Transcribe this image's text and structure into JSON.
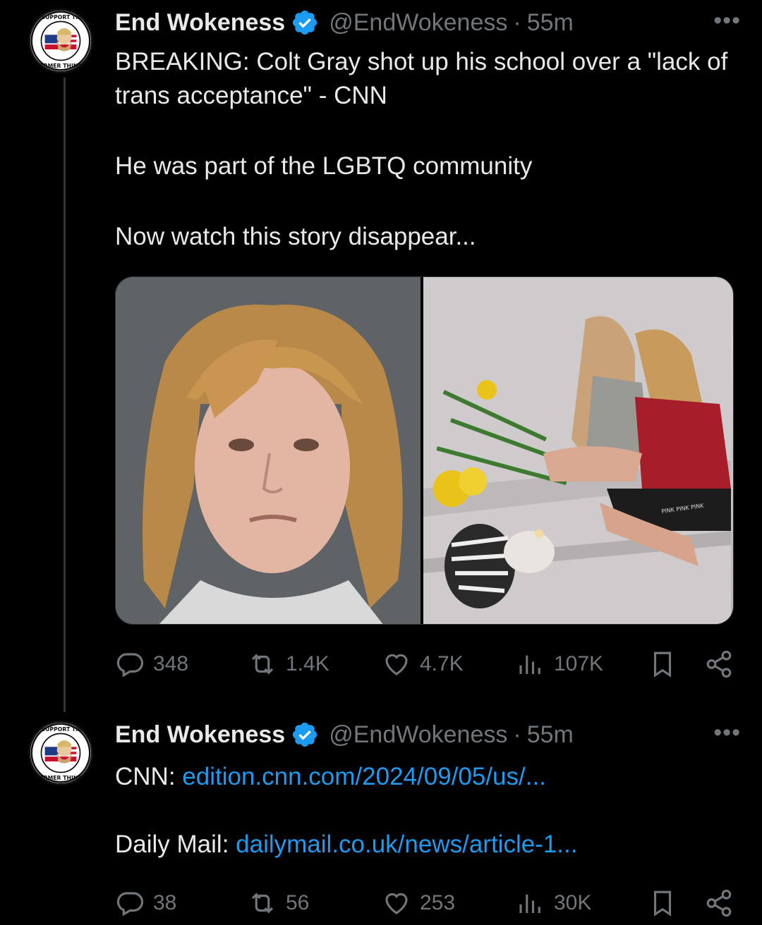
{
  "tweets": [
    {
      "author_name": "End Wokeness",
      "handle": "@EndWokeness",
      "separator": "·",
      "time": "55m",
      "more": "•••",
      "avatar_text_top": "I SUPPORT THE",
      "avatar_text_bottom": "FORMER THINGS",
      "lines": [
        "BREAKING: Colt Gray shot up his school over a \"lack of trans acceptance\" - CNN",
        "He was part of the LGBTQ community",
        "Now watch this story disappear..."
      ],
      "photo_right_texts": [
        "PINK PINK PINK"
      ],
      "stats": {
        "replies": "348",
        "reposts": "1.4K",
        "likes": "4.7K",
        "views": "107K"
      }
    },
    {
      "author_name": "End Wokeness",
      "handle": "@EndWokeness",
      "separator": "·",
      "time": "55m",
      "more": "•••",
      "avatar_text_top": "I SUPPORT THE",
      "avatar_text_bottom": "FORMER THINGS",
      "line1_prefix": "CNN: ",
      "line1_link": "edition.cnn.com/2024/09/05/us/...",
      "line2_prefix": "Daily Mail: ",
      "line2_link": "dailymail.co.uk/news/article-1...",
      "stats": {
        "replies": "38",
        "reposts": "56",
        "likes": "253",
        "views": "30K"
      }
    }
  ],
  "colors": {
    "background": "#000000",
    "text": "#e7e9ea",
    "muted": "#71767b",
    "link": "#1d9bf0",
    "verified": "#1d9bf0"
  },
  "icons": [
    "verified-badge-icon",
    "reply-icon",
    "repost-icon",
    "like-icon",
    "views-icon",
    "bookmark-icon",
    "share-icon",
    "more-icon"
  ]
}
